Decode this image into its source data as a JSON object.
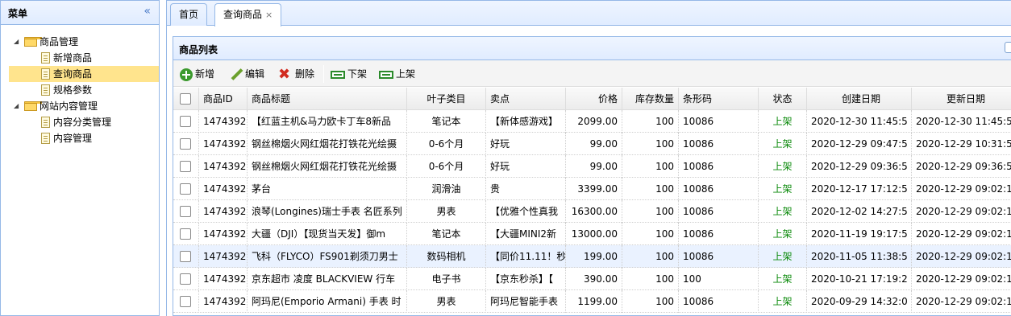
{
  "sidebar": {
    "title": "菜单",
    "collapse_icon": "double-chevron-left-icon",
    "tree": [
      {
        "label": "商品管理",
        "type": "folder"
      },
      {
        "label": "新增商品",
        "type": "file"
      },
      {
        "label": "查询商品",
        "type": "file",
        "selected": true
      },
      {
        "label": "规格参数",
        "type": "file"
      },
      {
        "label": "网站内容管理",
        "type": "folder"
      },
      {
        "label": "内容分类管理",
        "type": "file"
      },
      {
        "label": "内容管理",
        "type": "file"
      }
    ]
  },
  "tabs": [
    {
      "label": "首页"
    },
    {
      "label": "查询商品",
      "close": "×"
    }
  ],
  "panel": {
    "title": "商品列表"
  },
  "toolbar": {
    "add": "新增",
    "edit": "编辑",
    "delete": "删除",
    "off_shelf": "下架",
    "on_shelf": "上架"
  },
  "table": {
    "headers": {
      "id": "商品ID",
      "title": "商品标题",
      "category": "叶子类目",
      "sell_point": "卖点",
      "price": "价格",
      "stock": "库存数量",
      "barcode": "条形码",
      "status": "状态",
      "created": "创建日期",
      "updated": "更新日期"
    },
    "rows": [
      {
        "id": "1474392",
        "title": "【红蓝主机&马力欧卡丁车8新品",
        "category": "笔记本",
        "sell_point": "【新体感游戏】",
        "price": "2099.00",
        "stock": "100",
        "barcode": "10086",
        "status": "上架",
        "created": "2020-12-30 11:45:5",
        "updated": "2020-12-30 11:45:5"
      },
      {
        "id": "1474392",
        "title": "钢丝棉烟火网红烟花打铁花光绘摄",
        "category": "0-6个月",
        "sell_point": "好玩",
        "price": "99.00",
        "stock": "100",
        "barcode": "10086",
        "status": "上架",
        "created": "2020-12-29 09:47:5",
        "updated": "2020-12-29 10:31:5"
      },
      {
        "id": "1474392",
        "title": "钢丝棉烟火网红烟花打铁花光绘摄",
        "category": "0-6个月",
        "sell_point": "好玩",
        "price": "99.00",
        "stock": "100",
        "barcode": "10086",
        "status": "上架",
        "created": "2020-12-29 09:36:5",
        "updated": "2020-12-29 09:36:5"
      },
      {
        "id": "1474392",
        "title": "茅台",
        "category": "润滑油",
        "sell_point": "贵",
        "price": "3399.00",
        "stock": "100",
        "barcode": "10086",
        "status": "上架",
        "created": "2020-12-17 17:12:5",
        "updated": "2020-12-29 09:02:1"
      },
      {
        "id": "1474392",
        "title": "浪琴(Longines)瑞士手表 名匠系列",
        "category": "男表",
        "sell_point": "【优雅个性真我",
        "price": "16300.00",
        "stock": "100",
        "barcode": "10086",
        "status": "上架",
        "created": "2020-12-02 14:27:5",
        "updated": "2020-12-29 09:02:1"
      },
      {
        "id": "1474392",
        "title": "大疆（DJI）【现货当天发】御m",
        "category": "笔记本",
        "sell_point": "【大疆MINI2新",
        "price": "13000.00",
        "stock": "100",
        "barcode": "10086",
        "status": "上架",
        "created": "2020-11-19 19:17:5",
        "updated": "2020-12-29 09:02:1"
      },
      {
        "id": "1474392",
        "title": "飞科（FLYCO）FS901剃须刀男士",
        "category": "数码相机",
        "sell_point": "【同价11.11！秒",
        "price": "199.00",
        "stock": "100",
        "barcode": "10086",
        "status": "上架",
        "created": "2020-11-05 11:38:5",
        "updated": "2020-12-29 09:02:1"
      },
      {
        "id": "1474392",
        "title": "京东超市 凌度 BLACKVIEW 行车",
        "category": "电子书",
        "sell_point": "【京东秒杀】【",
        "price": "390.00",
        "stock": "100",
        "barcode": "100",
        "status": "上架",
        "created": "2020-10-21 17:19:2",
        "updated": "2020-12-29 09:02:1"
      },
      {
        "id": "1474392",
        "title": "阿玛尼(Emporio Armani) 手表 时",
        "category": "男表",
        "sell_point": "阿玛尼智能手表",
        "price": "1199.00",
        "stock": "100",
        "barcode": "10086",
        "status": "上架",
        "created": "2020-09-29 14:32:0",
        "updated": "2020-12-29 09:02:1"
      }
    ]
  },
  "colors": {
    "accent_border": "#95b8e7",
    "header_bg": "#e0ecff",
    "status_on": "#0b8a0b",
    "selected_node": "#ffe48d"
  }
}
